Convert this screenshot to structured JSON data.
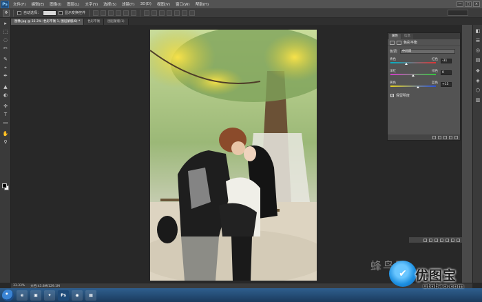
{
  "app": {
    "logo": "Ps"
  },
  "menu": [
    "文件(F)",
    "编辑(E)",
    "图像(I)",
    "图层(L)",
    "文字(Y)",
    "选择(S)",
    "滤镜(T)",
    "3D(D)",
    "视图(V)",
    "窗口(W)",
    "帮助(H)"
  ],
  "window_controls": [
    "—",
    "□",
    "×"
  ],
  "options": {
    "auto_select_label": "自动选择：",
    "show_transform_label": "显示变换控件",
    "tool_glyph": "✥"
  },
  "tabs": [
    "图像.jpg @ 33.3% (色彩平衡 1, 图层蒙版/8) *",
    "色彩平衡",
    "图层蒙版(1)"
  ],
  "tools": [
    "▸",
    "⬚",
    "◌",
    "✂",
    "✎",
    "⌖",
    "✒",
    "▲",
    "◐",
    "✜",
    "T",
    "▭",
    "✋",
    "⚲"
  ],
  "right_icons": [
    "◧",
    "☰",
    "◎",
    "▤",
    "❖",
    "◈",
    "⬡",
    "▥"
  ],
  "properties": {
    "tabs": [
      "属性",
      "信息"
    ],
    "title": "色彩平衡",
    "tone_label": "色调:",
    "tone_value": "中间调",
    "sliders": [
      {
        "left": "青色",
        "right": "红色",
        "value": "-31",
        "position": 0.35,
        "gradient_from": "#00b4c8",
        "gradient_to": "#e23232"
      },
      {
        "left": "洋红",
        "right": "绿色",
        "value": "0",
        "position": 0.5,
        "gradient_from": "#d23cc8",
        "gradient_to": "#32c83c"
      },
      {
        "left": "黄色",
        "right": "蓝色",
        "value": "+15",
        "position": 0.6,
        "gradient_from": "#e6d21e",
        "gradient_to": "#2850dc"
      }
    ],
    "preserve_label": "保留明度",
    "preserve_checked": "✓"
  },
  "status": {
    "zoom": "33.33%",
    "doc": "文档:43.8M/129.1M"
  },
  "taskbar_apps": [
    "e",
    "▣",
    "✦",
    "Ps",
    "◉",
    "▦"
  ],
  "watermark": {
    "line1": "蜂鸟网",
    "brand": "优图宝",
    "domain": "utobao.com",
    "bird": "✔"
  },
  "colors": {
    "accent": "#1d8fe0",
    "panel": "#535353",
    "canvas": "#282828"
  }
}
